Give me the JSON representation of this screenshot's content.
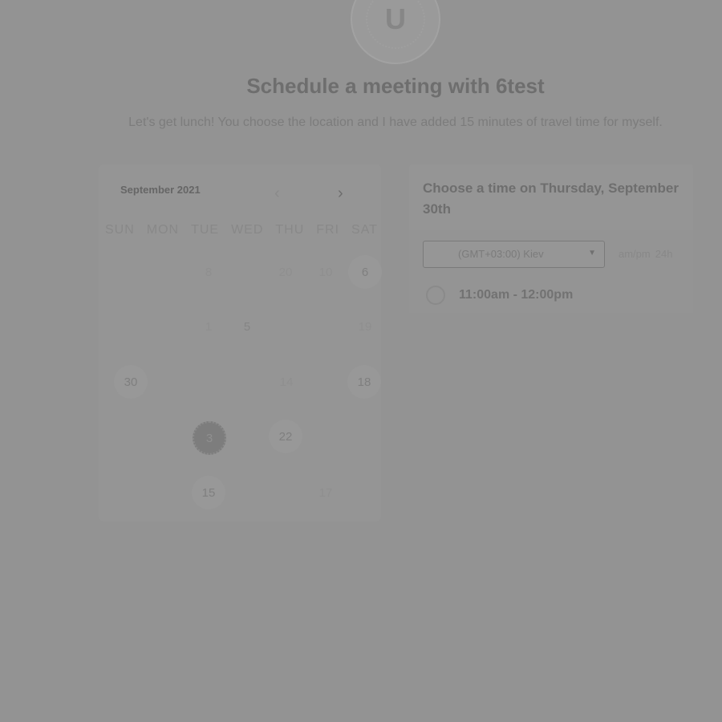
{
  "header": {
    "avatar_letter": "U",
    "title": "Schedule a meeting with 6test",
    "subtitle": "Let's get lunch! You choose the location and I have added 15 minutes of travel time for myself."
  },
  "calendar": {
    "month_label": "September 2021",
    "weekdays": [
      "SUN",
      "MON",
      "TUE",
      "WED",
      "THU",
      "FRI",
      "SAT"
    ],
    "days": {
      "d1": "8",
      "d2": "20",
      "d3": "10",
      "d4": "6",
      "d5": "1",
      "d6": "5",
      "d7": "19",
      "d8": "30",
      "d9": "14",
      "d10": "18",
      "d11": "3",
      "d12": "22",
      "d13": "15",
      "d14": "17"
    }
  },
  "times": {
    "title": "Choose a time on Thursday, September 30th",
    "timezone": "(GMT+03:00) Kiev",
    "format_ampm": "am/pm",
    "format_24h": "24h",
    "slots": [
      "11:00am - 12:00pm"
    ]
  }
}
